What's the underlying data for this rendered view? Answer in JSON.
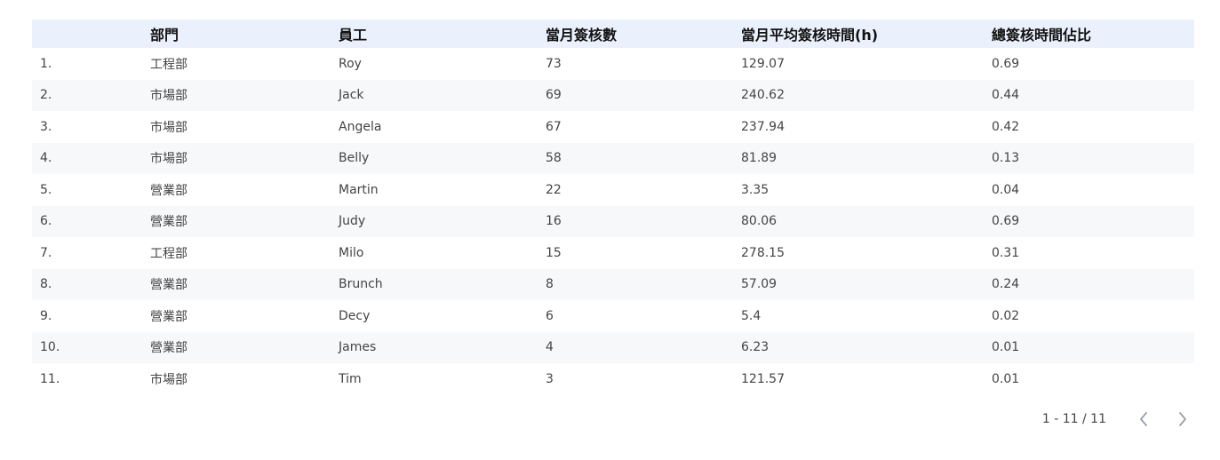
{
  "table": {
    "columns": {
      "index": "",
      "dept": "部門",
      "employee": "員工",
      "monthly_count": "當月簽核數",
      "monthly_avg_hours": "當月平均簽核時間(h)",
      "total_ratio": "總簽核時間佔比"
    },
    "rows": [
      {
        "index": "1.",
        "dept": "工程部",
        "employee": "Roy",
        "monthly_count": "73",
        "monthly_avg_hours": "129.07",
        "total_ratio": "0.69"
      },
      {
        "index": "2.",
        "dept": "市場部",
        "employee": "Jack",
        "monthly_count": "69",
        "monthly_avg_hours": "240.62",
        "total_ratio": "0.44"
      },
      {
        "index": "3.",
        "dept": "市場部",
        "employee": "Angela",
        "monthly_count": "67",
        "monthly_avg_hours": "237.94",
        "total_ratio": "0.42"
      },
      {
        "index": "4.",
        "dept": "市場部",
        "employee": "Belly",
        "monthly_count": "58",
        "monthly_avg_hours": "81.89",
        "total_ratio": "0.13"
      },
      {
        "index": "5.",
        "dept": "營業部",
        "employee": "Martin",
        "monthly_count": "22",
        "monthly_avg_hours": "3.35",
        "total_ratio": "0.04"
      },
      {
        "index": "6.",
        "dept": "營業部",
        "employee": "Judy",
        "monthly_count": "16",
        "monthly_avg_hours": "80.06",
        "total_ratio": "0.69"
      },
      {
        "index": "7.",
        "dept": "工程部",
        "employee": "Milo",
        "monthly_count": "15",
        "monthly_avg_hours": "278.15",
        "total_ratio": "0.31"
      },
      {
        "index": "8.",
        "dept": "營業部",
        "employee": "Brunch",
        "monthly_count": "8",
        "monthly_avg_hours": "57.09",
        "total_ratio": "0.24"
      },
      {
        "index": "9.",
        "dept": "營業部",
        "employee": "Decy",
        "monthly_count": "6",
        "monthly_avg_hours": "5.4",
        "total_ratio": "0.02"
      },
      {
        "index": "10.",
        "dept": "營業部",
        "employee": "James",
        "monthly_count": "4",
        "monthly_avg_hours": "6.23",
        "total_ratio": "0.01"
      },
      {
        "index": "11.",
        "dept": "市場部",
        "employee": "Tim",
        "monthly_count": "3",
        "monthly_avg_hours": "121.57",
        "total_ratio": "0.01"
      }
    ]
  },
  "pagination": {
    "text": "1 - 11 / 11",
    "prev_icon": "chevron-left-icon",
    "next_icon": "chevron-right-icon"
  },
  "colors": {
    "header_bg": "#eaf1fc",
    "stripe_bg": "#f7f8fa",
    "text": "#444444"
  }
}
